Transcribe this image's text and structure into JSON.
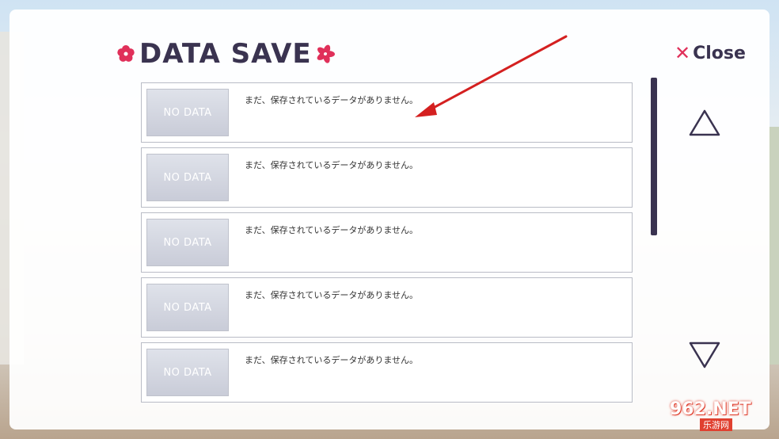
{
  "header": {
    "title": "DATA SAVE"
  },
  "close": {
    "label": "Close",
    "icon": "close-x-icon"
  },
  "slots": [
    {
      "thumb": "NO DATA",
      "text": "まだ、保存されているデータがありません。"
    },
    {
      "thumb": "NO DATA",
      "text": "まだ、保存されているデータがありません。"
    },
    {
      "thumb": "NO DATA",
      "text": "まだ、保存されているデータがありません。"
    },
    {
      "thumb": "NO DATA",
      "text": "まだ、保存されているデータがありません。"
    },
    {
      "thumb": "NO DATA",
      "text": "まだ、保存されているデータがありません。"
    }
  ],
  "nav": {
    "up_icon": "triangle-up-icon",
    "down_icon": "triangle-down-icon"
  },
  "colors": {
    "accent": "#e0305a",
    "text_dark": "#3a3350",
    "annotation_arrow": "#d42020"
  },
  "watermark": {
    "top": "962.NET",
    "bottom": "乐游网"
  }
}
